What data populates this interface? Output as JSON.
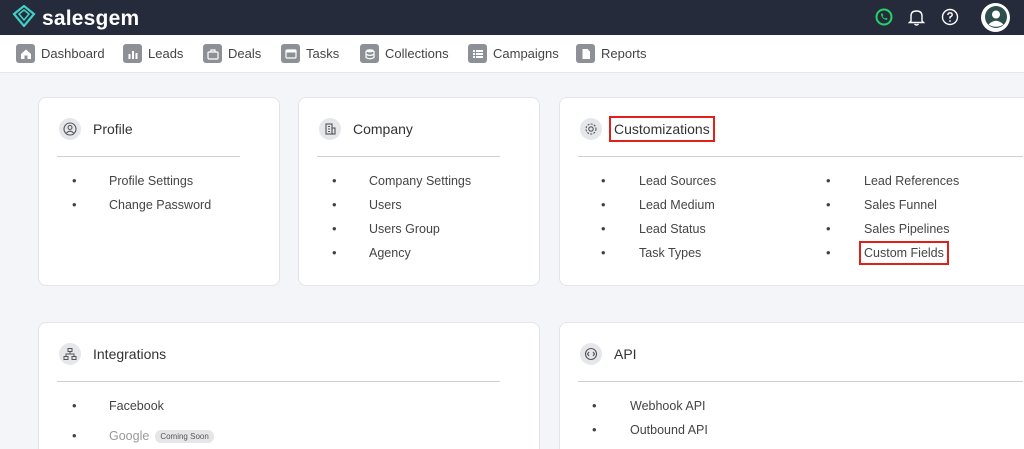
{
  "app": {
    "brand": "salesgem"
  },
  "nav": {
    "items": [
      {
        "label": "Dashboard",
        "icon": "home-icon"
      },
      {
        "label": "Leads",
        "icon": "bar-chart-icon"
      },
      {
        "label": "Deals",
        "icon": "briefcase-icon"
      },
      {
        "label": "Tasks",
        "icon": "tasks-icon"
      },
      {
        "label": "Collections",
        "icon": "database-icon"
      },
      {
        "label": "Campaigns",
        "icon": "list-icon"
      },
      {
        "label": "Reports",
        "icon": "document-icon"
      }
    ]
  },
  "cards": {
    "profile": {
      "title": "Profile",
      "items": [
        "Profile Settings",
        "Change Password"
      ]
    },
    "company": {
      "title": "Company",
      "items": [
        "Company Settings",
        "Users",
        "Users Group",
        "Agency"
      ]
    },
    "customizations": {
      "title": "Customizations",
      "left_items": [
        "Lead Sources",
        "Lead Medium",
        "Lead Status",
        "Task Types"
      ],
      "right_items": [
        "Lead References",
        "Sales Funnel",
        "Sales Pipelines",
        "Custom Fields"
      ]
    },
    "integrations": {
      "title": "Integrations",
      "items": [
        "Facebook",
        "Google"
      ],
      "badge": "Coming Soon"
    },
    "api": {
      "title": "API",
      "items": [
        "Webhook API",
        "Outbound API"
      ]
    }
  },
  "colors": {
    "topbar": "#262b3c",
    "highlight": "#e0201b",
    "whatsapp": "#25d366"
  }
}
